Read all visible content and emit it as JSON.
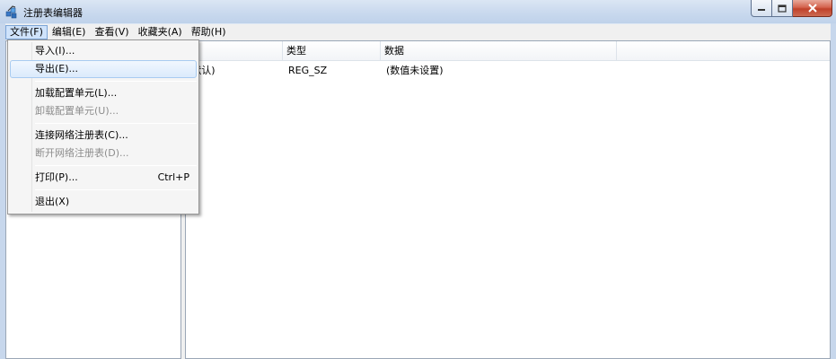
{
  "window": {
    "title": "注册表编辑器",
    "icon": "regedit-icon"
  },
  "titlebar_buttons": {
    "minimize_icon": "minimize-icon",
    "maximize_icon": "maximize-icon",
    "close_icon": "close-icon"
  },
  "menubar": {
    "items": [
      {
        "label": "文件(F)",
        "active": true
      },
      {
        "label": "编辑(E)"
      },
      {
        "label": "查看(V)"
      },
      {
        "label": "收藏夹(A)"
      },
      {
        "label": "帮助(H)"
      }
    ]
  },
  "list": {
    "columns": [
      "称",
      "类型",
      "数据"
    ],
    "rows": [
      {
        "name": "(默认)",
        "type": "REG_SZ",
        "data": "(数值未设置)"
      }
    ]
  },
  "file_menu": {
    "items": [
      {
        "label": "导入(I)...",
        "enabled": true
      },
      {
        "label": "导出(E)...",
        "enabled": true,
        "highlighted": true
      },
      {
        "label": "加载配置单元(L)...",
        "enabled": true
      },
      {
        "label": "卸载配置单元(U)...",
        "enabled": false
      },
      {
        "label": "连接网络注册表(C)...",
        "enabled": true
      },
      {
        "label": "断开网络注册表(D)...",
        "enabled": false
      },
      {
        "label": "打印(P)...",
        "enabled": true,
        "shortcut": "Ctrl+P"
      },
      {
        "label": "退出(X)",
        "enabled": true
      }
    ]
  },
  "colors": {
    "menu_highlight": "#dbeafc",
    "close_button": "#c0412a",
    "disabled_text": "#8d8d8d"
  }
}
